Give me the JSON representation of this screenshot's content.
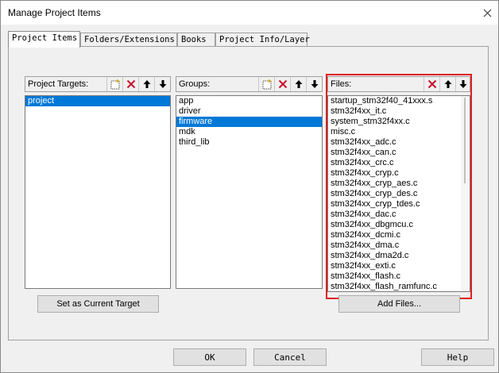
{
  "window": {
    "title": "Manage Project Items"
  },
  "tabs": [
    {
      "label": "Project Items"
    },
    {
      "label": "Folders/Extensions"
    },
    {
      "label": "Books"
    },
    {
      "label": "Project Info/Layer"
    }
  ],
  "targets": {
    "header": "Project Targets:",
    "items": [
      "project"
    ],
    "selected_index": 0,
    "set_current_label": "Set as Current Target"
  },
  "groups": {
    "header": "Groups:",
    "items": [
      "app",
      "driver",
      "firmware",
      "mdk",
      "third_lib"
    ],
    "selected_index": 2
  },
  "files": {
    "header": "Files:",
    "items": [
      "startup_stm32f40_41xxx.s",
      "stm32f4xx_it.c",
      "system_stm32f4xx.c",
      "misc.c",
      "stm32f4xx_adc.c",
      "stm32f4xx_can.c",
      "stm32f4xx_crc.c",
      "stm32f4xx_cryp.c",
      "stm32f4xx_cryp_aes.c",
      "stm32f4xx_cryp_des.c",
      "stm32f4xx_cryp_tdes.c",
      "stm32f4xx_dac.c",
      "stm32f4xx_dbgmcu.c",
      "stm32f4xx_dcmi.c",
      "stm32f4xx_dma.c",
      "stm32f4xx_dma2d.c",
      "stm32f4xx_exti.c",
      "stm32f4xx_flash.c",
      "stm32f4xx_flash_ramfunc.c"
    ],
    "add_files_label": "Add Files..."
  },
  "footer": {
    "ok_label": "OK",
    "cancel_label": "Cancel",
    "help_label": "Help"
  },
  "colors": {
    "selection": "#0078d7",
    "highlight_border": "#e02020"
  }
}
